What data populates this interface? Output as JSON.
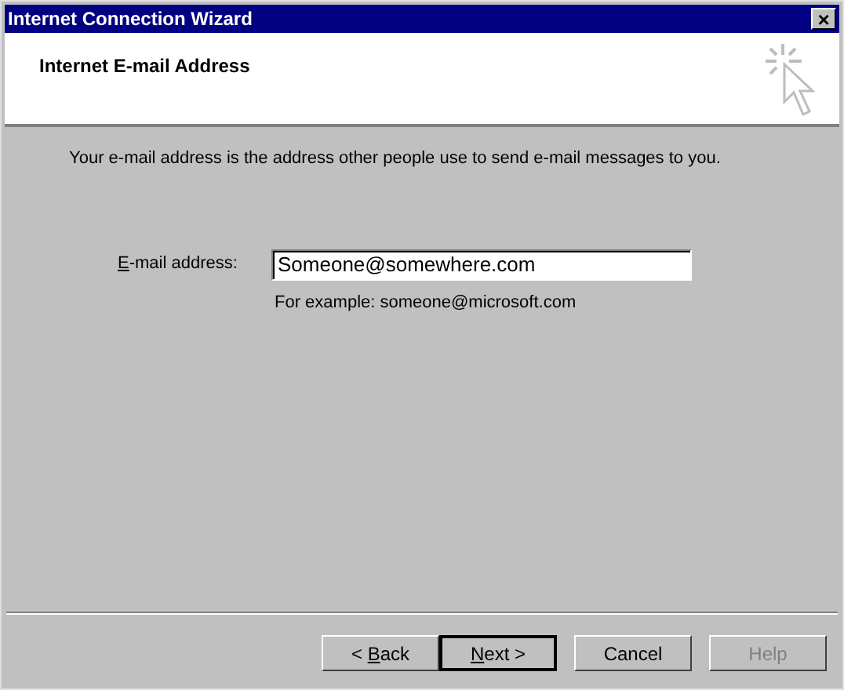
{
  "window": {
    "title": "Internet Connection Wizard",
    "close": "×"
  },
  "header": {
    "title": "Internet E-mail Address"
  },
  "intro": "Your e-mail address is the address other people use to send e-mail messages to you.",
  "email": {
    "label": {
      "mnemonic": "E",
      "after": "-mail address:"
    },
    "value": "Someone@somewhere.com",
    "hint": "For example: someone@microsoft.com"
  },
  "buttons": [
    {
      "before": "< ",
      "mnemonic": "B",
      "after": "ack",
      "default": false,
      "disabled": false
    },
    {
      "mnemonic": "N",
      "after": "ext >",
      "default": true,
      "disabled": false
    },
    {
      "after": "Cancel",
      "default": false,
      "disabled": false
    },
    {
      "after": "Help",
      "default": false,
      "disabled": true
    }
  ]
}
